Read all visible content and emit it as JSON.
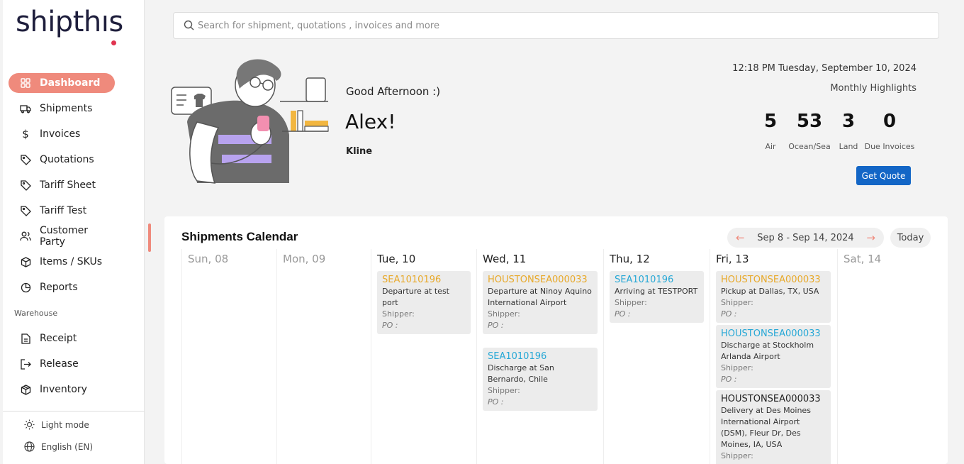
{
  "brand": {
    "logo_text": "shipthıs",
    "accent": "#ef8a7c",
    "dot_color": "#e0334f"
  },
  "sidebar": {
    "items": [
      {
        "label": "Dashboard",
        "icon": "grid-icon"
      },
      {
        "label": "Shipments",
        "icon": "truck-icon"
      },
      {
        "label": "Invoices",
        "icon": "dollar-icon"
      },
      {
        "label": "Quotations",
        "icon": "tag-icon"
      },
      {
        "label": "Tariff Sheet",
        "icon": "tag-icon"
      },
      {
        "label": "Tariff Test",
        "icon": "tag-icon"
      },
      {
        "label": "Customer Party",
        "icon": "users-icon"
      },
      {
        "label": "Items / SKUs",
        "icon": "box-icon"
      },
      {
        "label": "Reports",
        "icon": "pie-chart-icon"
      }
    ],
    "section_warehouse": "Warehouse",
    "warehouse_items": [
      {
        "label": "Receipt",
        "icon": "file-icon"
      },
      {
        "label": "Release",
        "icon": "logout-icon"
      },
      {
        "label": "Inventory",
        "icon": "package-icon"
      }
    ],
    "light_mode": "Light mode",
    "language": "English (EN)"
  },
  "search": {
    "placeholder": "Search for shipment, quotations , invoices and more"
  },
  "header": {
    "greeting": "Good Afternoon :)",
    "name": "Alex!",
    "company": "Kline",
    "datetime": "12:18 PM Tuesday, September 10, 2024",
    "monthly": "Monthly Highlights",
    "stats": [
      {
        "value": "5",
        "label": "Air"
      },
      {
        "value": "53",
        "label": "Ocean/Sea"
      },
      {
        "value": "3",
        "label": "Land"
      },
      {
        "value": "0",
        "label": "Due Invoices"
      }
    ],
    "get_quote": "Get Quote"
  },
  "calendar": {
    "title": "Shipments Calendar",
    "range": "Sep 8 - Sep 14, 2024",
    "today": "Today",
    "days": [
      "Sun, 08",
      "Mon, 09",
      "Tue, 10",
      "Wed, 11",
      "Thu, 12",
      "Fri, 13",
      "Sat, 14"
    ],
    "shipper_label": "Shipper:",
    "po_label": "PO :",
    "events": {
      "tue_1": {
        "code": "SEA1010196",
        "desc": "Departure at test port"
      },
      "wed_1": {
        "code": "HOUSTONSEA000033",
        "desc": "Departure at Ninoy Aquino International Airport"
      },
      "wed_2": {
        "code": "SEA1010196",
        "desc": "Discharge at San Bernardo, Chile"
      },
      "thu_1": {
        "code": "SEA1010196",
        "desc": "Arriving at TESTPORT"
      },
      "fri_1": {
        "code": "HOUSTONSEA000033",
        "desc": "Pickup at Dallas, TX, USA"
      },
      "fri_2": {
        "code": "HOUSTONSEA000033",
        "desc": "Discharge at Stockholm Arlanda Airport"
      },
      "fri_3": {
        "code": "HOUSTONSEA000033",
        "desc": "Delivery at Des Moines International Airport (DSM), Fleur Dr, Des Moines, IA, USA"
      }
    }
  }
}
